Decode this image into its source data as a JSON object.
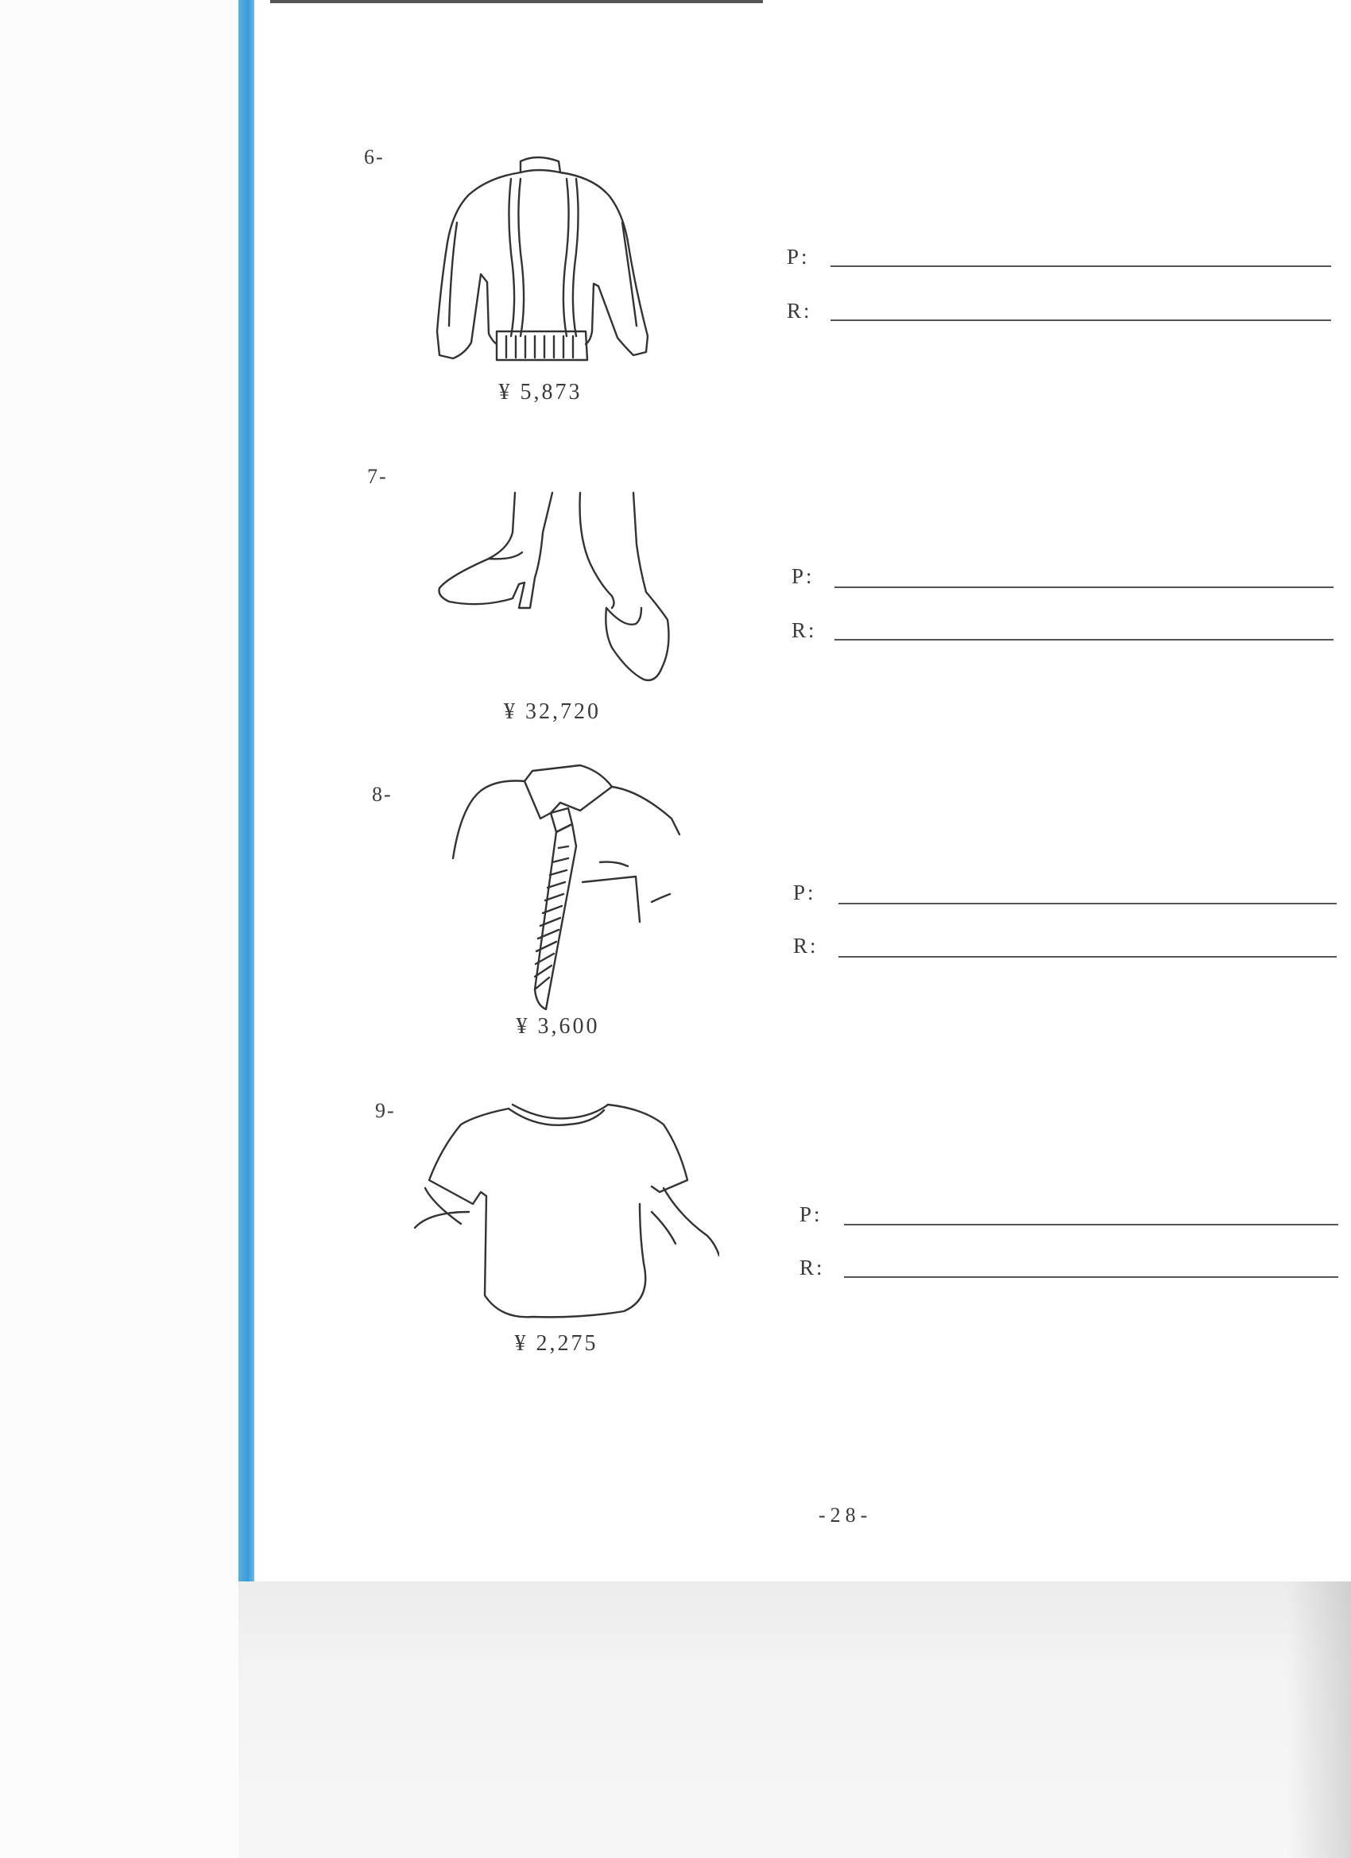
{
  "items": [
    {
      "number": "6-",
      "price": "¥ 5,873",
      "p_label": "P:",
      "r_label": "R:",
      "icon": "sweater-icon"
    },
    {
      "number": "7-",
      "price": "¥ 32,720",
      "p_label": "P:",
      "r_label": "R:",
      "icon": "high-heel-shoes-icon"
    },
    {
      "number": "8-",
      "price": "¥ 3,600",
      "p_label": "P:",
      "r_label": "R:",
      "icon": "shirt-and-tie-icon"
    },
    {
      "number": "9-",
      "price": "¥ 2,275",
      "p_label": "P:",
      "r_label": "R:",
      "icon": "t-shirt-icon"
    }
  ],
  "page_number": "-28-",
  "colors": {
    "spine_blue": "#3a9ad6",
    "ink": "#333333"
  }
}
